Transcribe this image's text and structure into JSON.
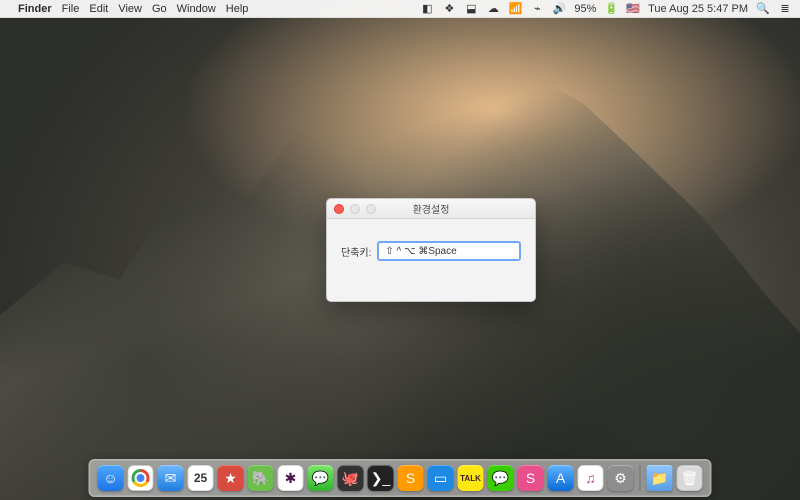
{
  "menubar": {
    "app_name": "Finder",
    "items": [
      "File",
      "Edit",
      "View",
      "Go",
      "Window",
      "Help"
    ],
    "battery_text": "95%",
    "input_flag": "🇺🇸",
    "clock": "Tue Aug 25  5:47 PM"
  },
  "pref_window": {
    "title": "환경설정",
    "label": "단축키:",
    "shortcut_value": "⇧ ^ ⌥ ⌘Space"
  },
  "dock": {
    "calendar_day": "25",
    "kakao_label": "TALK"
  }
}
